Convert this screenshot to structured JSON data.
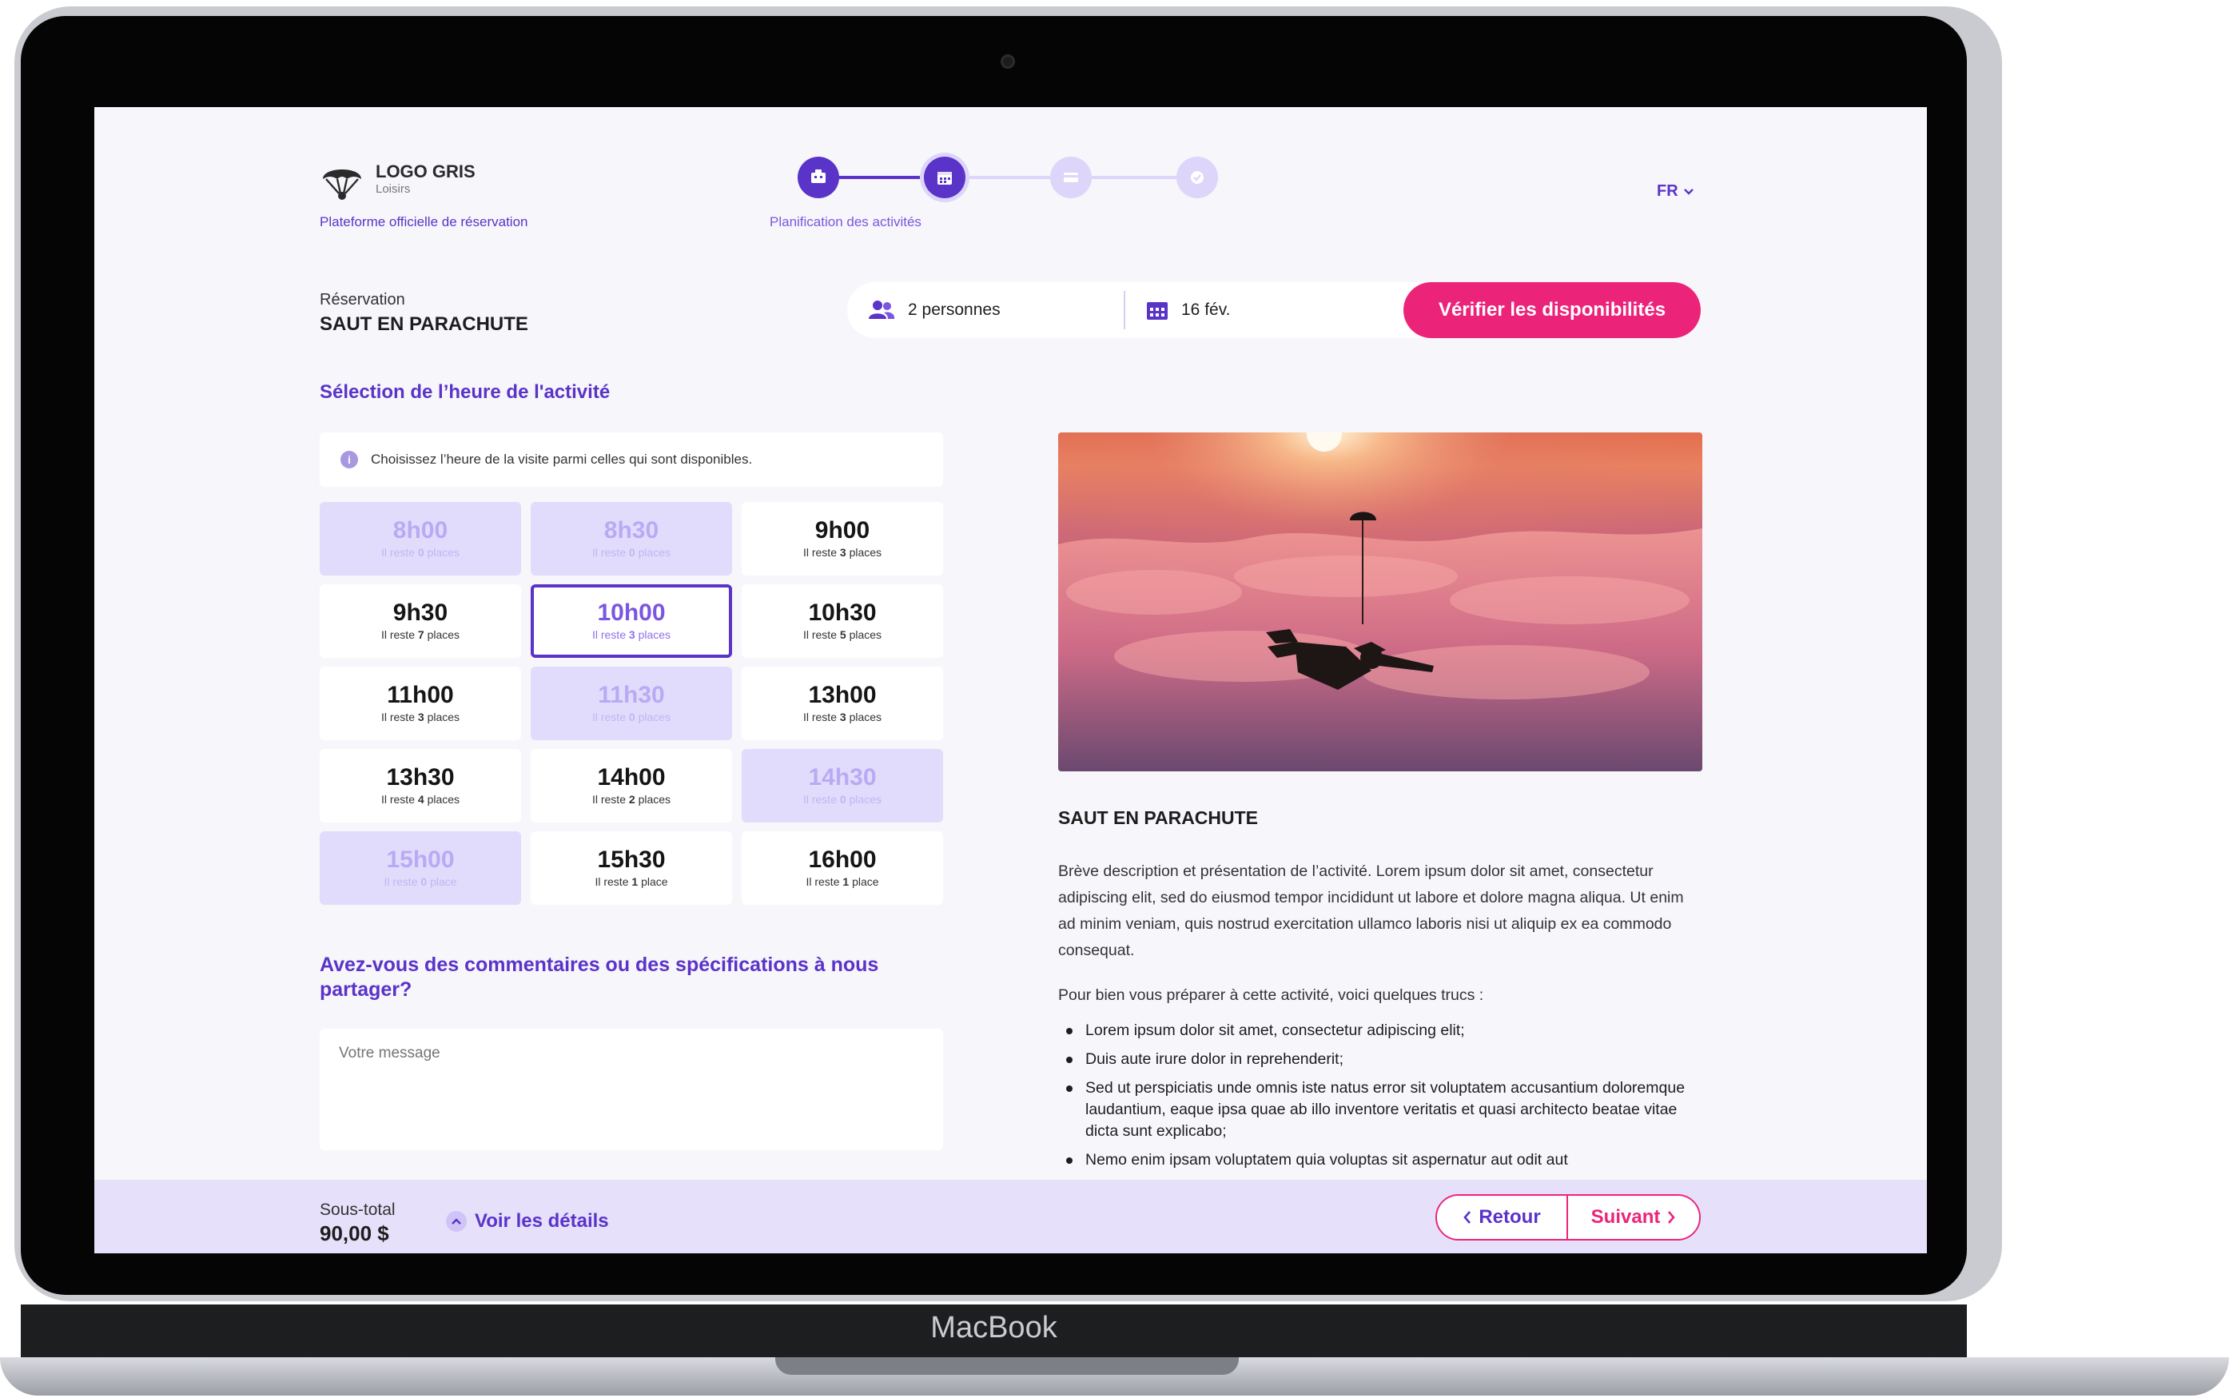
{
  "device": {
    "brand": "MacBook"
  },
  "header": {
    "logo_title": "LOGO GRIS",
    "logo_subtitle": "Loisirs",
    "platform": "Plateforme officielle de réservation",
    "step_label": "Planification des activités",
    "language": "FR"
  },
  "reservation": {
    "label": "Réservation",
    "title": "SAUT EN PARACHUTE",
    "persons": "2 personnes",
    "date": "16 fév.",
    "check_button": "Vérifier les disponibilités"
  },
  "time_selection": {
    "title": "Sélection de l’heure de l'activité",
    "info": "Choisissez l’heure de la visite parmi celles qui sont disponibles.",
    "slots": [
      {
        "time": "8h00",
        "prefix": "Il reste",
        "count": "0",
        "unit": "places",
        "state": "disabled"
      },
      {
        "time": "8h30",
        "prefix": "Il reste",
        "count": "0",
        "unit": "places",
        "state": "disabled"
      },
      {
        "time": "9h00",
        "prefix": "Il reste",
        "count": "3",
        "unit": "places",
        "state": "available"
      },
      {
        "time": "9h30",
        "prefix": "Il reste",
        "count": "7",
        "unit": "places",
        "state": "available"
      },
      {
        "time": "10h00",
        "prefix": "Il reste",
        "count": "3",
        "unit": "places",
        "state": "selected"
      },
      {
        "time": "10h30",
        "prefix": "Il reste",
        "count": "5",
        "unit": "places",
        "state": "available"
      },
      {
        "time": "11h00",
        "prefix": "Il reste",
        "count": "3",
        "unit": "places",
        "state": "available"
      },
      {
        "time": "11h30",
        "prefix": "Il reste",
        "count": "0",
        "unit": "places",
        "state": "disabled"
      },
      {
        "time": "13h00",
        "prefix": "Il reste",
        "count": "3",
        "unit": "places",
        "state": "available"
      },
      {
        "time": "13h30",
        "prefix": "Il reste",
        "count": "4",
        "unit": "places",
        "state": "available"
      },
      {
        "time": "14h00",
        "prefix": "Il reste",
        "count": "2",
        "unit": "places",
        "state": "available"
      },
      {
        "time": "14h30",
        "prefix": "Il reste",
        "count": "0",
        "unit": "places",
        "state": "disabled"
      },
      {
        "time": "15h00",
        "prefix": "Il reste",
        "count": "0",
        "unit": "place",
        "state": "disabled"
      },
      {
        "time": "15h30",
        "prefix": "Il reste",
        "count": "1",
        "unit": "place",
        "state": "available"
      },
      {
        "time": "16h00",
        "prefix": "Il reste",
        "count": "1",
        "unit": "place",
        "state": "available"
      }
    ]
  },
  "comments": {
    "title": "Avez-vous des commentaires ou des spécifications à nous partager?",
    "placeholder": "Votre message"
  },
  "activity": {
    "title": "SAUT EN PARACHUTE",
    "description": "Brève description et présentation de l’activité. Lorem ipsum dolor sit amet, consectetur adipiscing elit, sed do eiusmod tempor incididunt ut labore et dolore magna aliqua. Ut enim ad minim veniam, quis nostrud exercitation ullamco laboris nisi ut aliquip ex ea commodo consequat.",
    "prep_intro": "Pour bien vous préparer à cette activité, voici quelques trucs :",
    "tips": [
      "Lorem ipsum dolor sit amet, consectetur adipiscing elit;",
      "Duis aute irure dolor in reprehenderit;",
      "Sed ut perspiciatis unde omnis iste natus error sit voluptatem accusantium doloremque laudantium, eaque ipsa quae ab illo inventore veritatis et quasi architecto beatae vitae dicta sunt explicabo;",
      "Nemo enim ipsam voluptatem quia voluptas sit aspernatur aut odit aut"
    ]
  },
  "footer": {
    "subtotal_label": "Sous-total",
    "subtotal_value": "90,00 $",
    "details": "Voir les détails",
    "back": "Retour",
    "next": "Suivant"
  },
  "colors": {
    "accent": "#5a33c9",
    "pink": "#ec2479",
    "disabled_bg": "#e2dcfc",
    "footer_bg": "#e6e0fb"
  }
}
